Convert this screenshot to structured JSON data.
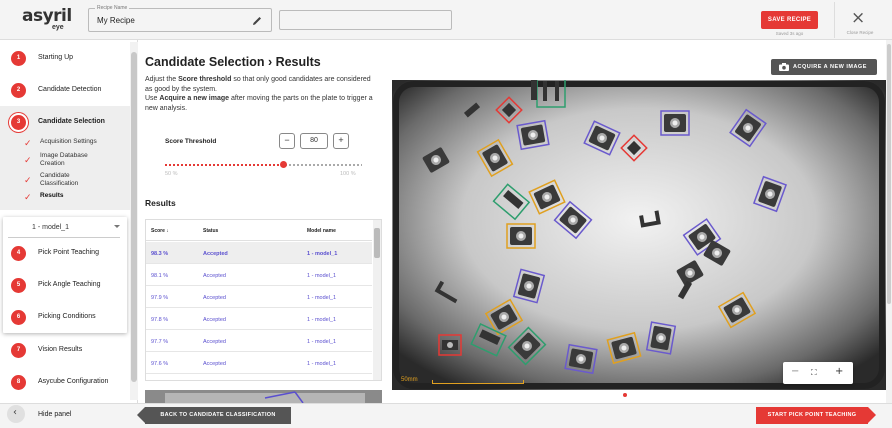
{
  "header": {
    "logo_main": "asyril",
    "logo_sub": "eye",
    "recipe_label": "Recipe Name",
    "recipe_name": "My Recipe",
    "save_label": "SAVE RECIPE",
    "saved_ago": "Saved 3s ago",
    "close_symbol": "×",
    "close_label": "Close Recipe",
    "accent_color": "#e53935"
  },
  "sidebar": {
    "steps": [
      {
        "num": "1",
        "label": "Starting Up"
      },
      {
        "num": "2",
        "label": "Candidate Detection"
      },
      {
        "num": "3",
        "label": "Candidate Selection",
        "active": true
      },
      {
        "num": "4",
        "label": "Pick Point Teaching"
      },
      {
        "num": "5",
        "label": "Pick Angle Teaching"
      },
      {
        "num": "6",
        "label": "Picking Conditions"
      },
      {
        "num": "7",
        "label": "Vision Results"
      },
      {
        "num": "8",
        "label": "Asycube Configuration"
      }
    ],
    "substeps": [
      {
        "label": "Acquisition Settings"
      },
      {
        "label": "Image Database Creation"
      },
      {
        "label": "Candidate Classification"
      },
      {
        "label": "Results",
        "current": true
      }
    ],
    "model_select_value": "1 - model_1",
    "hide_label": "Hide panel"
  },
  "main": {
    "title": "Candidate Selection  ›  Results",
    "desc_line1_pre": "Adjust the ",
    "desc_line1_bold": "Score threshold",
    "desc_line1_post": " so that only good candidates are considered as good by the system.",
    "desc_line2_pre": "Use ",
    "desc_line2_bold": "Acquire a new image",
    "desc_line2_post": " after moving the parts on the plate to trigger a new analysis.",
    "acquire_label": "ACQUIRE A NEW IMAGE",
    "score_threshold_label": "Score Threshold",
    "score_value": "80",
    "slider_min": "50 %",
    "slider_max": "100 %",
    "slider_level_percent": 60,
    "results_title": "Results",
    "table": {
      "headers": [
        "Score ↓",
        "Status",
        "Model name"
      ],
      "rows": [
        {
          "score": "98.3 %",
          "status": "Accepted",
          "model": "1 - model_1",
          "selected": true
        },
        {
          "score": "98.1 %",
          "status": "Accepted",
          "model": "1 - model_1"
        },
        {
          "score": "97.9 %",
          "status": "Accepted",
          "model": "1 - model_1"
        },
        {
          "score": "97.8 %",
          "status": "Accepted",
          "model": "1 - model_1"
        },
        {
          "score": "97.7 %",
          "status": "Accepted",
          "model": "1 - model_1"
        },
        {
          "score": "97.6 %",
          "status": "Accepted",
          "model": "1 - model_1"
        }
      ]
    },
    "scalebar_label": "50mm",
    "zoom": {
      "minus": "−",
      "fit": "⛶",
      "plus": "+"
    }
  },
  "footer": {
    "back_label": "BACK TO CANDIDATE CLASSIFICATION",
    "start_label": "START PICK POINT TEACHING"
  },
  "icons": [
    "pencil-icon",
    "close-icon",
    "check-icon",
    "chevron-left-icon",
    "camera-icon",
    "chevron-down-icon",
    "zoom-out-icon",
    "zoom-fit-icon",
    "zoom-in-icon"
  ]
}
